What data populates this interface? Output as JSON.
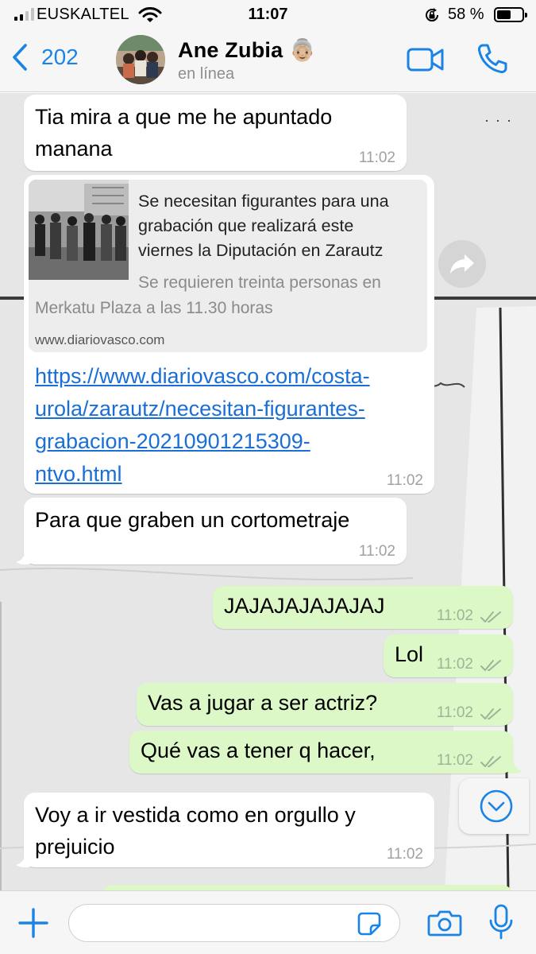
{
  "status_bar": {
    "carrier": "EUSKALTEL",
    "time": "11:07",
    "battery_percent": "58 %",
    "battery_level": 0.58,
    "icons": [
      "signal-icon",
      "wifi-icon",
      "orientation-lock-icon",
      "battery-icon"
    ]
  },
  "header": {
    "back_count": "202",
    "contact_name": "Ane Zubia 👵🏼",
    "contact_status": "en línea",
    "icons": [
      "back-chevron-icon",
      "video-call-icon",
      "phone-call-icon"
    ]
  },
  "messages": [
    {
      "direction": "in",
      "lines": [
        "Tia mira a que me he apuntado",
        "manana"
      ],
      "time": "11:02"
    },
    {
      "direction": "in",
      "link_preview": {
        "title_lines": [
          "Se necesitan figurantes para una",
          "grabación que realizará este",
          "viernes la Diputación en Zarautz"
        ],
        "desc_line1": "Se requieren treinta personas en",
        "desc_line2": "Merkatu Plaza a las 11.30 horas",
        "domain": "www.diariovasco.com"
      },
      "url_lines": [
        "https://www.diariovasco.com/costa-",
        "urola/zarautz/necesitan-figurantes-",
        "grabacion-20210901215309-",
        "ntvo.html"
      ],
      "time": "11:02"
    },
    {
      "direction": "in",
      "lines": [
        "Para que graben un cortometraje"
      ],
      "time": "11:02"
    },
    {
      "direction": "out",
      "lines": [
        "JAJAJAJAJAJAJ"
      ],
      "time": "11:02",
      "read": true
    },
    {
      "direction": "out",
      "lines": [
        "Lol"
      ],
      "time": "11:02",
      "read": true
    },
    {
      "direction": "out",
      "lines": [
        "Vas a jugar a ser actriz?"
      ],
      "time": "11:02",
      "read": true
    },
    {
      "direction": "out",
      "lines": [
        "Qué vas a tener q hacer,"
      ],
      "time": "11:02",
      "read": true
    },
    {
      "direction": "in",
      "lines": [
        "Voy a ir vestida como en orgullo y",
        "prejuicio"
      ],
      "time": "11:02"
    }
  ],
  "composer": {
    "message_value": "",
    "icons": [
      "plus-icon",
      "sticker-icon",
      "camera-icon",
      "microphone-icon"
    ]
  },
  "colors": {
    "accent": "#1a84e6",
    "outgoing_bubble": "#dcf8c6",
    "incoming_bubble": "#ffffff",
    "link": "#1a6fd6"
  }
}
